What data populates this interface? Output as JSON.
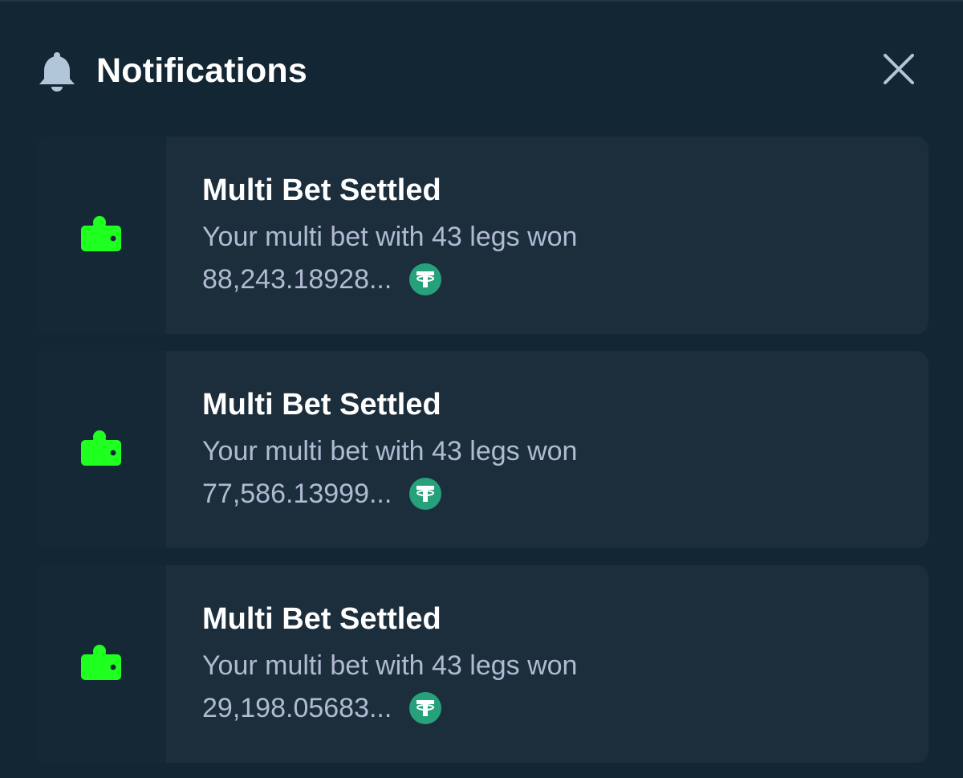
{
  "header": {
    "title": "Notifications",
    "icon": "bell-icon",
    "close_icon": "close-icon"
  },
  "colors": {
    "background": "#132634",
    "card": "#1c2e3b",
    "icon_green": "#1fff20",
    "tether": "#26a17b",
    "text_muted": "#b1bad3"
  },
  "notifications": [
    {
      "icon": "wallet-icon",
      "title": "Multi Bet Settled",
      "text": "Your multi bet with 43 legs won",
      "amount": "88,243.18928...",
      "currency_icon": "tether-icon"
    },
    {
      "icon": "wallet-icon",
      "title": "Multi Bet Settled",
      "text": "Your multi bet with 43 legs won",
      "amount": "77,586.13999...",
      "currency_icon": "tether-icon"
    },
    {
      "icon": "wallet-icon",
      "title": "Multi Bet Settled",
      "text": "Your multi bet with 43 legs won",
      "amount": "29,198.05683...",
      "currency_icon": "tether-icon"
    }
  ]
}
